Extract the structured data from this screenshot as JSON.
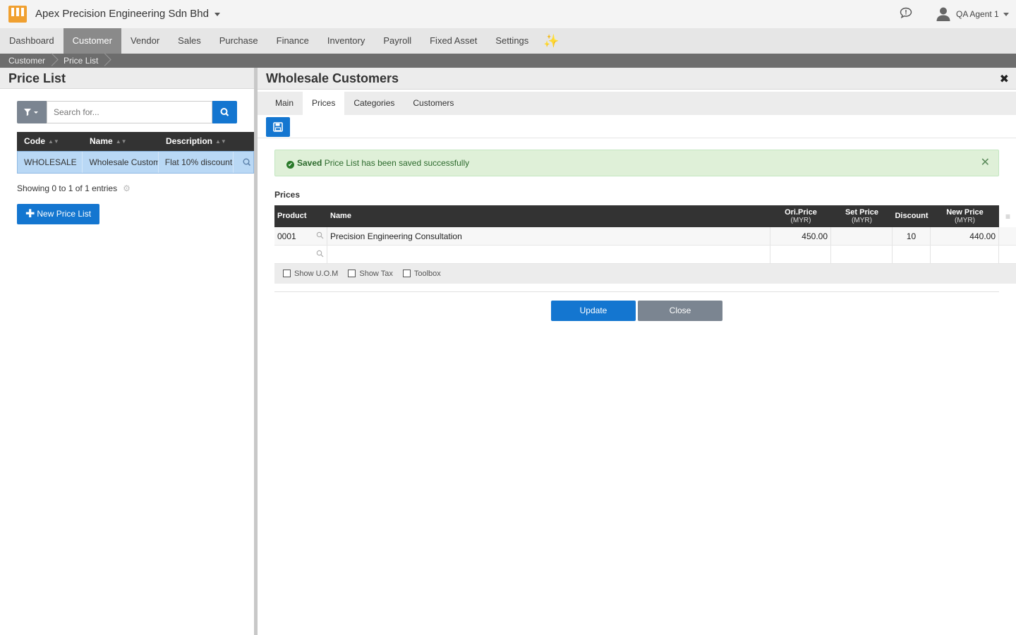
{
  "app": {
    "company": "Apex Precision Engineering Sdn Bhd",
    "user": "QA Agent 1"
  },
  "nav": {
    "items": [
      "Dashboard",
      "Customer",
      "Vendor",
      "Sales",
      "Purchase",
      "Finance",
      "Inventory",
      "Payroll",
      "Fixed Asset",
      "Settings"
    ],
    "active": "Customer",
    "sparkle": "✨"
  },
  "breadcrumb": [
    "Customer",
    "Price List"
  ],
  "left": {
    "title": "Price List",
    "search_placeholder": "Search for...",
    "columns": [
      "Code",
      "Name",
      "Description"
    ],
    "rows": [
      {
        "code": "WHOLESALE",
        "name": "Wholesale Customers",
        "description": "Flat 10% discount"
      }
    ],
    "showing": "Showing 0 to 1 of 1 entries",
    "new_button": "New Price List"
  },
  "right": {
    "title": "Wholesale Customers",
    "tabs": [
      "Main",
      "Prices",
      "Categories",
      "Customers"
    ],
    "active_tab": "Prices",
    "alert": {
      "strong": "Saved",
      "text": "Price List has been saved successfully"
    },
    "section_title": "Prices",
    "grid": {
      "headers": {
        "product": "Product",
        "name": "Name",
        "ori_price": "Ori.Price",
        "set_price": "Set Price",
        "discount": "Discount",
        "new_price": "New Price",
        "currency": "(MYR)"
      },
      "rows": [
        {
          "product": "0001",
          "name": "Precision Engineering Consultation",
          "ori_price": "450.00",
          "set_price": "",
          "discount": "10",
          "new_price": "440.00"
        }
      ],
      "footer_options": [
        "Show U.O.M",
        "Show Tax",
        "Toolbox"
      ]
    },
    "update_button": "Update",
    "close_button": "Close"
  }
}
